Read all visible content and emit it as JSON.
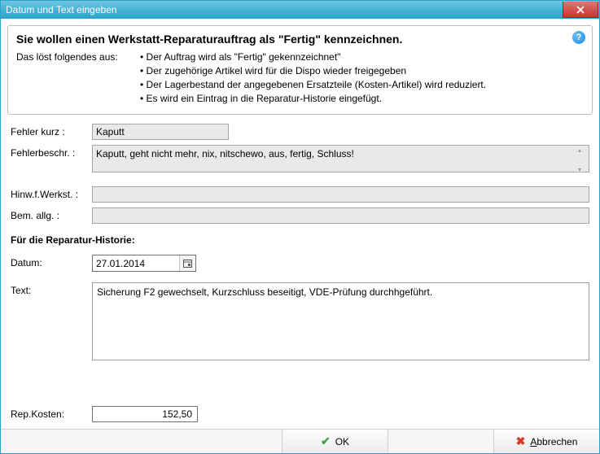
{
  "window": {
    "title": "Datum und Text eingeben"
  },
  "info": {
    "heading": "Sie wollen einen Werkstatt-Reparaturauftrag als \"Fertig\" kennzeichnen.",
    "lead": "Das löst folgendes aus:",
    "bullets": [
      "Der Auftrag wird als \"Fertig\" gekennzeichnet\"",
      "Der zugehörige Artikel wird für die Dispo wieder freigegeben",
      "Der Lagerbestand der angegebenen Ersatzteile (Kosten-Artikel) wird reduziert.",
      "Es wird ein Eintrag in die Reparatur-Historie eingefügt."
    ],
    "help_icon": "?"
  },
  "labels": {
    "fehler_kurz": "Fehler kurz :",
    "fehlerbeschr": "Fehlerbeschr. :",
    "hinw_werkst": "Hinw.f.Werkst. :",
    "bem_allg": "Bem. allg. :",
    "history_head": "Für die Reparatur-Historie:",
    "datum": "Datum:",
    "text": "Text:",
    "rep_kosten": "Rep.Kosten:"
  },
  "values": {
    "fehler_kurz": "Kaputt",
    "fehlerbeschr": "Kaputt, geht nicht mehr, nix, nitschewo, aus, fertig, Schluss!",
    "hinw_werkst": "",
    "bem_allg": "",
    "datum": "27.01.2014",
    "text": "Sicherung F2 gewechselt, Kurzschluss beseitigt, VDE-Prüfung durchhgeführt.",
    "rep_kosten": "152,50"
  },
  "buttons": {
    "ok": "OK",
    "cancel_prefix": "A",
    "cancel_rest": "bbrechen"
  }
}
